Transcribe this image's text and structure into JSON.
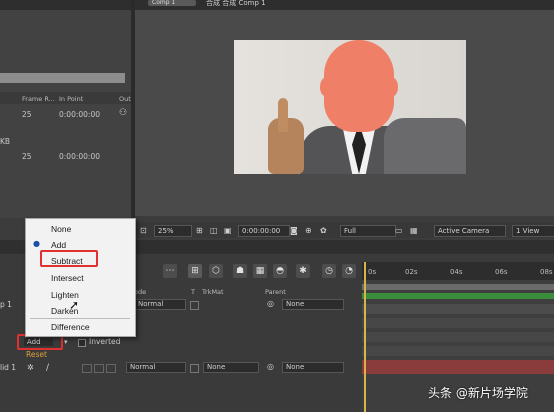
{
  "topbar": {
    "comp_tab": "Comp 1",
    "comp_label": "合成 合成 Comp 1"
  },
  "project": {
    "headers": {
      "frame_rate": "Frame R...",
      "in_point": "In Point",
      "out": "Out"
    },
    "rows": [
      {
        "frame_rate": "25",
        "in_point": "0:00:00:00"
      },
      {
        "size": "KB",
        "frame_rate": "25",
        "in_point": "0:00:00:00"
      }
    ]
  },
  "viewer_toolbar": {
    "zoom": "25%",
    "timecode": "0:00:00:00",
    "resolution": "Full",
    "camera": "Active Camera",
    "views": "1 View"
  },
  "timeline": {
    "ticks": [
      "0s",
      "02s",
      "04s",
      "06s",
      "08s"
    ],
    "columns": {
      "mode": "ode",
      "t": "T",
      "trkmat": "TrkMat",
      "parent": "Parent"
    },
    "layer1": {
      "label": "p 1",
      "mode": "Normal",
      "parent": "None"
    },
    "mask": {
      "mode": "Add",
      "inverted_label": "Inverted",
      "reset_label": "Reset"
    },
    "layer2": {
      "label": "lid 1",
      "mode": "Normal",
      "trkmat": "None",
      "parent": "None"
    }
  },
  "mask_mode_menu": {
    "items": [
      "None",
      "Add",
      "Subtract",
      "Intersect",
      "Lighten",
      "Darken",
      "Difference"
    ],
    "checked": "Add",
    "highlighted": "Subtract"
  },
  "watermark": "头条 @新片场学院",
  "colors": {
    "highlight_box": "#e03030",
    "mask_fill": "#ef7f66",
    "cti": "#d8b24a",
    "keyframe": "#e0b84a"
  }
}
